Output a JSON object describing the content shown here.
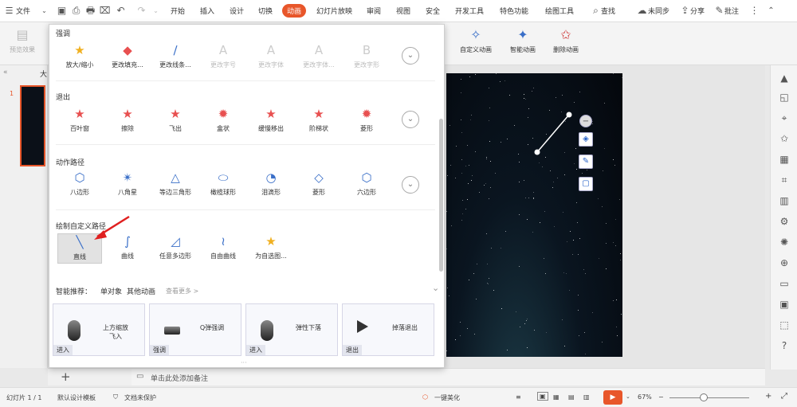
{
  "menubar": {
    "file": "文件",
    "tabs": [
      "开始",
      "插入",
      "设计",
      "切换",
      "动画",
      "幻灯片放映",
      "审阅",
      "视图",
      "安全",
      "开发工具",
      "特色功能",
      "绘图工具"
    ],
    "active_tab": "动画",
    "search": "查找",
    "sync": "未同步",
    "share": "分享",
    "comment": "批注"
  },
  "ribbon": {
    "preview": "预览效果",
    "custom_animation": "自定义动画",
    "smart_animation": "智能动画",
    "delete_animation": "删除动画"
  },
  "thumbs": {
    "header": "大",
    "slide_number": "1"
  },
  "panel": {
    "emphasis_title": "强调",
    "emphasis_items": [
      {
        "label": "放大/缩小",
        "icon": "star-grow-icon",
        "disabled": false
      },
      {
        "label": "更改填充...",
        "icon": "fill-color-icon",
        "disabled": false
      },
      {
        "label": "更改线条...",
        "icon": "line-color-icon",
        "disabled": false
      },
      {
        "label": "更改字号",
        "icon": "font-size-icon",
        "disabled": true
      },
      {
        "label": "更改字体",
        "icon": "font-icon",
        "disabled": true
      },
      {
        "label": "更改字体...",
        "icon": "font-color-icon",
        "disabled": true
      },
      {
        "label": "更改字形",
        "icon": "font-style-icon",
        "disabled": true
      }
    ],
    "exit_title": "退出",
    "exit_items": [
      "百叶窗",
      "擦除",
      "飞出",
      "盒状",
      "缓慢移出",
      "阶梯状",
      "菱形"
    ],
    "path_title": "动作路径",
    "path_items": [
      "八边形",
      "八角星",
      "等边三角形",
      "橄榄球形",
      "泪滴形",
      "菱形",
      "六边形"
    ],
    "custom_title": "绘制自定义路径",
    "custom_items": [
      "直线",
      "曲线",
      "任意多边形",
      "自由曲线",
      "为自选图..."
    ],
    "smart_label": "智能推荐：",
    "smart_tab1": "单对象",
    "smart_tab2": "其他动画",
    "more": "查看更多 >",
    "cards": [
      {
        "label": "上方缩放\n飞入",
        "tag": "进入"
      },
      {
        "label": "Q弹强调",
        "tag": "强调"
      },
      {
        "label": "弹性下落",
        "tag": "进入"
      },
      {
        "label": "掉落退出",
        "tag": "退出"
      }
    ]
  },
  "notes": {
    "placeholder": "单击此处添加备注",
    "add": "+"
  },
  "status": {
    "slide": "幻灯片 1 / 1",
    "template": "默认设计模板",
    "protect": "文档未保护",
    "beautify": "一键美化",
    "zoom": "67%"
  },
  "colors": {
    "accent": "#e8562a",
    "icon_blue": "#3a6fc8",
    "star_red": "#e85050",
    "star_yellow": "#f0b020"
  }
}
